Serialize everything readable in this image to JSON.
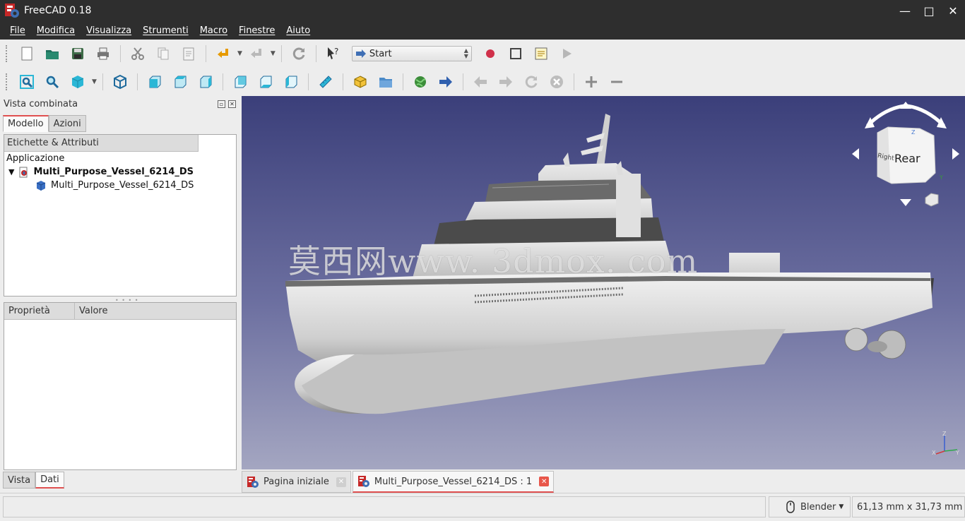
{
  "window": {
    "title": "FreeCAD 0.18",
    "minimize": "—",
    "maximize": "□",
    "close": "✕"
  },
  "menubar": [
    "File",
    "Modifica",
    "Visualizza",
    "Strumenti",
    "Macro",
    "Finestre",
    "Aiuto"
  ],
  "toolbar": {
    "workbench": "Start"
  },
  "combo_view": {
    "title": "Vista combinata",
    "tabs": [
      "Modello",
      "Azioni"
    ],
    "tree_header": "Etichette & Attributi",
    "tree_root": "Applicazione",
    "document": "Multi_Purpose_Vessel_6214_DS",
    "object": "Multi_Purpose_Vessel_6214_DS",
    "property_columns": [
      "Proprietà",
      "Valore"
    ],
    "bottom_tabs": [
      "Vista",
      "Dati"
    ]
  },
  "viewport": {
    "watermark": "莫西网www. 3dmox. com",
    "navcube_face": "Rear",
    "navcube_side": "Right",
    "axis": {
      "x": "X",
      "y": "Y",
      "z": "Z"
    },
    "background_top": "#3b3f7a",
    "background_bottom": "#a4a6c1"
  },
  "doc_tabs": [
    {
      "label": "Pagina iniziale",
      "active": false
    },
    {
      "label": "Multi_Purpose_Vessel_6214_DS : 1",
      "active": true
    }
  ],
  "statusbar": {
    "navigation": "Blender",
    "dimensions": "61,13 mm x 31,73 mm"
  },
  "colors": {
    "accent": "#e05050",
    "titlebar": "#2e2e2e",
    "cyan_icon": "#2bb7d6"
  }
}
